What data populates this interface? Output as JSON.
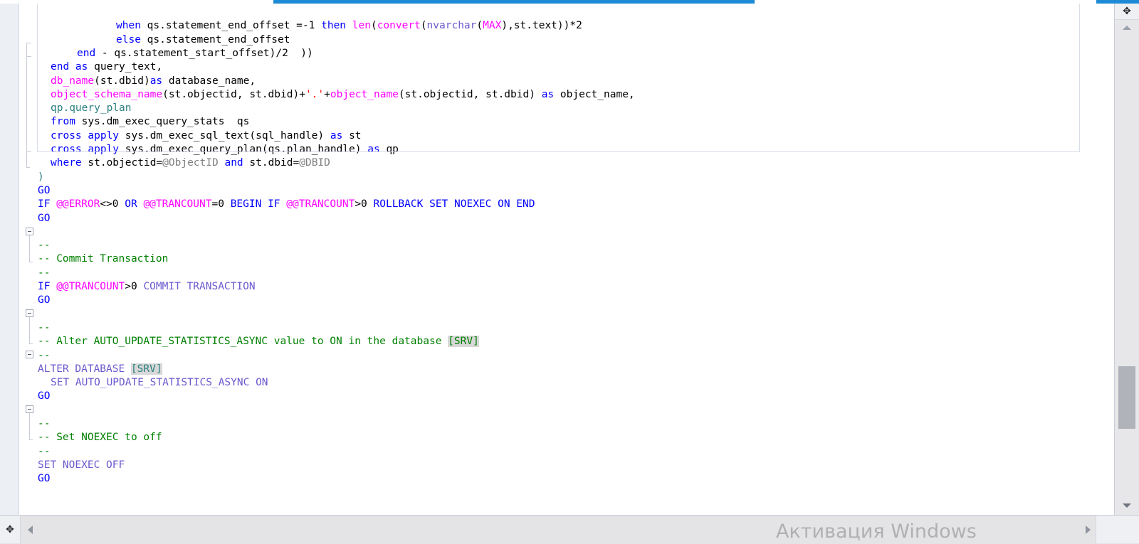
{
  "app": {
    "name": "sql-code-editor",
    "language": "T-SQL"
  },
  "colors": {
    "keyword": "#0000ff",
    "keyword_light": "#6a5acd",
    "system_function": "#ff00ff",
    "comment": "#008000",
    "identifier": "#808080",
    "string": "#ff0000",
    "selection": "#1c8ad4",
    "highlight": "#d8d8d8",
    "editor_background": "#ffffff",
    "margin_background": "#eceff4",
    "scrollbar_track": "#e7e7ea",
    "scrollbar_thumb": "#b0b3b9"
  },
  "editor": {
    "lines": [
      {
        "indent": 0,
        "segments": []
      },
      {
        "indent": 110,
        "segments": [
          {
            "t": "when ",
            "c": "kw"
          },
          {
            "t": "qs.statement_end_offset ",
            "c": "plain"
          },
          {
            "t": "=",
            "c": "plain"
          },
          {
            "t": "-1",
            "c": "plain"
          },
          {
            "t": " ",
            "c": "plain"
          },
          {
            "t": "then ",
            "c": "kw"
          },
          {
            "t": "len",
            "c": "fn"
          },
          {
            "t": "(",
            "c": "plain"
          },
          {
            "t": "convert",
            "c": "fn"
          },
          {
            "t": "(",
            "c": "plain"
          },
          {
            "t": "nvarchar",
            "c": "kw2"
          },
          {
            "t": "(",
            "c": "plain"
          },
          {
            "t": "MAX",
            "c": "fn"
          },
          {
            "t": ")",
            "c": "plain"
          },
          {
            "t": ",st.text))*2",
            "c": "plain"
          }
        ]
      },
      {
        "indent": 110,
        "segments": [
          {
            "t": "else ",
            "c": "kw"
          },
          {
            "t": "qs.statement_end_offset",
            "c": "plain"
          }
        ]
      },
      {
        "indent": 55,
        "segments": [
          {
            "t": "end ",
            "c": "kw"
          },
          {
            "t": "- qs.statement_start_offset)/",
            "c": "plain"
          },
          {
            "t": "2",
            "c": "plain"
          },
          {
            "t": "  ))",
            "c": "plain"
          }
        ]
      },
      {
        "indent": 18,
        "segments": [
          {
            "t": "end ",
            "c": "kw"
          },
          {
            "t": "as ",
            "c": "kw"
          },
          {
            "t": "query_text,",
            "c": "plain"
          }
        ]
      },
      {
        "indent": 18,
        "segments": [
          {
            "t": "db_name",
            "c": "fn"
          },
          {
            "t": "(st.dbid)",
            "c": "plain"
          },
          {
            "t": "as ",
            "c": "kw"
          },
          {
            "t": "database_name,",
            "c": "plain"
          }
        ]
      },
      {
        "indent": 18,
        "segments": [
          {
            "t": "object_schema_name",
            "c": "fn"
          },
          {
            "t": "(st.objectid, st.dbid)+",
            "c": "plain"
          },
          {
            "t": "'.'",
            "c": "str"
          },
          {
            "t": "+",
            "c": "plain"
          },
          {
            "t": "object_name",
            "c": "fn"
          },
          {
            "t": "(st.objectid, st.dbid) ",
            "c": "plain"
          },
          {
            "t": "as ",
            "c": "kw"
          },
          {
            "t": "object_name,",
            "c": "plain"
          }
        ]
      },
      {
        "indent": 18,
        "segments": [
          {
            "t": "qp.query_plan",
            "c": "teal"
          }
        ]
      },
      {
        "indent": 18,
        "segments": [
          {
            "t": "from ",
            "c": "kw"
          },
          {
            "t": "sys.dm_exec_query_stats  qs",
            "c": "plain"
          }
        ]
      },
      {
        "indent": 18,
        "segments": [
          {
            "t": "cross ",
            "c": "kw"
          },
          {
            "t": "apply ",
            "c": "kw"
          },
          {
            "t": "sys.dm_exec_sql_text(sql_handle) ",
            "c": "plain"
          },
          {
            "t": "as ",
            "c": "kw"
          },
          {
            "t": "st",
            "c": "plain"
          }
        ]
      },
      {
        "indent": 18,
        "segments": [
          {
            "t": "cross ",
            "c": "kw"
          },
          {
            "t": "apply ",
            "c": "kw"
          },
          {
            "t": "sys.dm_exec_query_plan(qs.plan_handle) ",
            "c": "plain"
          },
          {
            "t": "as ",
            "c": "kw"
          },
          {
            "t": "qp",
            "c": "plain"
          }
        ]
      },
      {
        "indent": 18,
        "segments": [
          {
            "t": "where ",
            "c": "kw"
          },
          {
            "t": "st.objectid=",
            "c": "plain"
          },
          {
            "t": "@ObjectID",
            "c": "ident"
          },
          {
            "t": " ",
            "c": "plain"
          },
          {
            "t": "and ",
            "c": "kw"
          },
          {
            "t": "st.dbid=",
            "c": "plain"
          },
          {
            "t": "@DBID",
            "c": "ident"
          }
        ]
      },
      {
        "indent": 0,
        "segments": [
          {
            "t": ")",
            "c": "teal"
          }
        ]
      },
      {
        "indent": 0,
        "segments": [
          {
            "t": "GO",
            "c": "kw"
          }
        ]
      },
      {
        "indent": 0,
        "segments": [
          {
            "t": "IF ",
            "c": "kw"
          },
          {
            "t": "@@ERROR",
            "c": "fn"
          },
          {
            "t": "<>",
            "c": "plain"
          },
          {
            "t": "0",
            "c": "plain"
          },
          {
            "t": " ",
            "c": "plain"
          },
          {
            "t": "OR ",
            "c": "kw"
          },
          {
            "t": "@@TRANCOUNT",
            "c": "fn"
          },
          {
            "t": "=",
            "c": "plain"
          },
          {
            "t": "0",
            "c": "plain"
          },
          {
            "t": " ",
            "c": "plain"
          },
          {
            "t": "BEGIN ",
            "c": "kw"
          },
          {
            "t": "IF ",
            "c": "kw"
          },
          {
            "t": "@@TRANCOUNT",
            "c": "fn"
          },
          {
            "t": ">",
            "c": "plain"
          },
          {
            "t": "0",
            "c": "plain"
          },
          {
            "t": " ",
            "c": "plain"
          },
          {
            "t": "ROLLBACK SET NOEXEC ON END",
            "c": "kw"
          }
        ]
      },
      {
        "indent": 0,
        "segments": [
          {
            "t": "GO",
            "c": "kw"
          }
        ]
      },
      {
        "indent": 0,
        "segments": []
      },
      {
        "indent": 0,
        "segments": [
          {
            "t": "--",
            "c": "cmt"
          }
        ]
      },
      {
        "indent": 0,
        "segments": [
          {
            "t": "-- Commit Transaction",
            "c": "cmt"
          }
        ]
      },
      {
        "indent": 0,
        "segments": [
          {
            "t": "--",
            "c": "cmt"
          }
        ]
      },
      {
        "indent": 0,
        "segments": [
          {
            "t": "IF ",
            "c": "kw"
          },
          {
            "t": "@@TRANCOUNT",
            "c": "fn"
          },
          {
            "t": ">",
            "c": "plain"
          },
          {
            "t": "0",
            "c": "plain"
          },
          {
            "t": " ",
            "c": "plain"
          },
          {
            "t": "COMMIT TRANSACTION",
            "c": "kw2"
          }
        ]
      },
      {
        "indent": 0,
        "segments": [
          {
            "t": "GO",
            "c": "kw"
          }
        ]
      },
      {
        "indent": 0,
        "segments": []
      },
      {
        "indent": 0,
        "segments": [
          {
            "t": "--",
            "c": "cmt"
          }
        ]
      },
      {
        "indent": 0,
        "segments": [
          {
            "t": "-- Alter AUTO_UPDATE_STATISTICS_ASYNC value to ON in the database ",
            "c": "cmt"
          },
          {
            "t": "[SRV]",
            "c": "cmt hl"
          }
        ]
      },
      {
        "indent": 0,
        "segments": [
          {
            "t": "--",
            "c": "cmt"
          }
        ]
      },
      {
        "indent": 0,
        "segments": [
          {
            "t": "ALTER DATABASE ",
            "c": "kw2"
          },
          {
            "t": "[SRV]",
            "c": "teal hl"
          }
        ]
      },
      {
        "indent": 18,
        "segments": [
          {
            "t": "SET AUTO_UPDATE_STATISTICS_ASYNC ON",
            "c": "kw2"
          }
        ]
      },
      {
        "indent": 0,
        "segments": [
          {
            "t": "GO",
            "c": "kw"
          }
        ]
      },
      {
        "indent": 0,
        "segments": []
      },
      {
        "indent": 0,
        "segments": [
          {
            "t": "--",
            "c": "cmt"
          }
        ]
      },
      {
        "indent": 0,
        "segments": [
          {
            "t": "-- Set NOEXEC to off",
            "c": "cmt"
          }
        ]
      },
      {
        "indent": 0,
        "segments": [
          {
            "t": "--",
            "c": "cmt"
          }
        ]
      },
      {
        "indent": 0,
        "segments": [
          {
            "t": "SET NOEXEC OFF",
            "c": "kw2"
          }
        ]
      },
      {
        "indent": 0,
        "segments": [
          {
            "t": "GO",
            "c": "kw"
          }
        ]
      }
    ],
    "plain_text": [
      "            when qs.statement_end_offset =-1 then len(convert(nvarchar(MAX),st.text))*2",
      "            else qs.statement_end_offset",
      "        end - qs.statement_start_offset)/2  ))",
      "  end as query_text,",
      "  db_name(st.dbid)as database_name,",
      "  object_schema_name(st.objectid, st.dbid)+'.'+object_name(st.objectid, st.dbid) as object_name,",
      "  qp.query_plan",
      "  from sys.dm_exec_query_stats  qs",
      "  cross apply sys.dm_exec_sql_text(sql_handle) as st",
      "  cross apply sys.dm_exec_query_plan(qs.plan_handle) as qp",
      "  where st.objectid=@ObjectID and st.dbid=@DBID",
      ")",
      "GO",
      "IF @@ERROR<>0 OR @@TRANCOUNT=0 BEGIN IF @@TRANCOUNT>0 ROLLBACK SET NOEXEC ON END",
      "GO",
      "",
      "--",
      "-- Commit Transaction",
      "--",
      "IF @@TRANCOUNT>0 COMMIT TRANSACTION",
      "GO",
      "",
      "--",
      "-- Alter AUTO_UPDATE_STATISTICS_ASYNC value to ON in the database [SRV]",
      "--",
      "ALTER DATABASE [SRV]",
      "  SET AUTO_UPDATE_STATISTICS_ASYNC ON",
      "GO",
      "",
      "--",
      "-- Set NOEXEC to off",
      "--",
      "SET NOEXEC OFF",
      "GO"
    ]
  },
  "scrollbars": {
    "vertical": {
      "split_handle_icon": "split-vertical-icon",
      "up_arrow_icon": "scroll-up-icon",
      "down_arrow_icon": "scroll-down-icon",
      "thumb": "vertical-scroll-thumb"
    },
    "horizontal": {
      "split_handle_icon": "split-horizontal-icon",
      "left_arrow_icon": "scroll-left-icon",
      "right_arrow_icon": "scroll-right-icon"
    }
  },
  "watermark": {
    "text": "Активация Windows"
  }
}
